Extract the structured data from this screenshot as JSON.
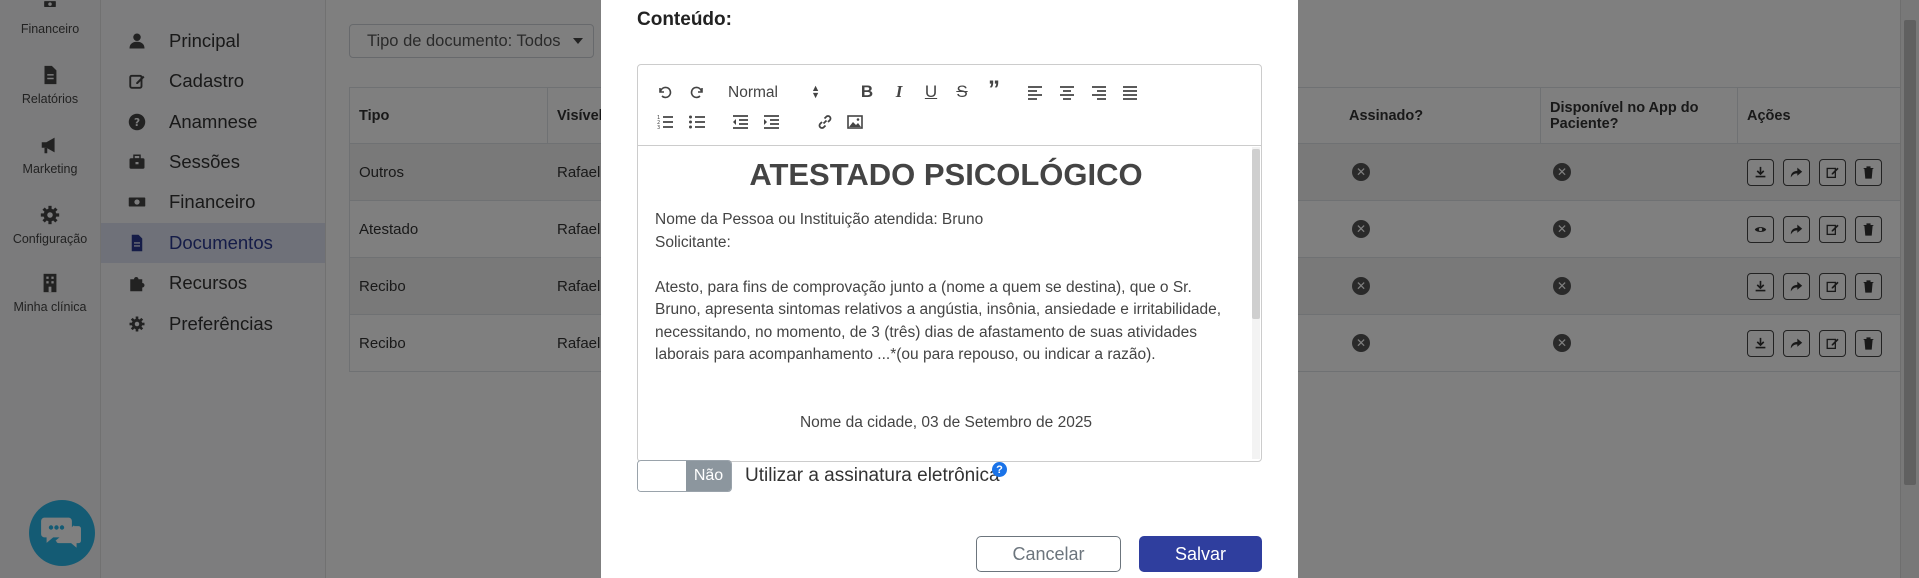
{
  "rail": {
    "items": [
      {
        "label": "Financeiro",
        "icon": "money-icon"
      },
      {
        "label": "Relatórios",
        "icon": "file-icon"
      },
      {
        "label": "Marketing",
        "icon": "megaphone-icon"
      },
      {
        "label": "Configuração",
        "icon": "gear-icon"
      },
      {
        "label": "Minha clínica",
        "icon": "building-icon"
      }
    ]
  },
  "menu": {
    "items": [
      {
        "label": "Principal",
        "icon": "user-icon"
      },
      {
        "label": "Cadastro",
        "icon": "edit-icon"
      },
      {
        "label": "Anamnese",
        "icon": "question-icon"
      },
      {
        "label": "Sessões",
        "icon": "briefcase-icon"
      },
      {
        "label": "Financeiro",
        "icon": "money-icon"
      },
      {
        "label": "Documentos",
        "icon": "file-icon",
        "active": true
      },
      {
        "label": "Recursos",
        "icon": "puzzle-icon"
      },
      {
        "label": "Preferências",
        "icon": "gear-icon"
      }
    ]
  },
  "filter": {
    "label": "Tipo de documento: Todos"
  },
  "table": {
    "headers": [
      "Tipo",
      "Visível",
      "Assinado?",
      "Disponível no App do Paciente?",
      "Ações"
    ],
    "rows": [
      {
        "tipo": "Outros",
        "visivel": "Rafael"
      },
      {
        "tipo": "Atestado",
        "visivel": "Rafael"
      },
      {
        "tipo": "Recibo",
        "visivel": "Rafael"
      },
      {
        "tipo": "Recibo",
        "visivel": "Rafael"
      }
    ]
  },
  "modal": {
    "section_title": "Conteúdo:",
    "toolbar": {
      "size": "Normal"
    },
    "content": {
      "heading": "ATESTADO PSICOLÓGICO",
      "line1": "Nome da Pessoa ou Instituição atendida: Bruno",
      "line2": "Solicitante:",
      "paragraph": "Atesto, para fins de comprovação junto a (nome a quem se destina), que o Sr. Bruno, apresenta sintomas relativos a angústia, insônia, ansiedade e irritabilidade, necessitando, no momento, de 3 (três) dias de afastamento de suas atividades laborais para acompanhamento ...*(ou para repouso, ou indicar a razão).",
      "date_line": "Nome da cidade, 03 de Setembro de 2025"
    },
    "toggle_label": "Não",
    "signature_label": "Utilizar a assinatura eletrônica",
    "help": "?",
    "cancel": "Cancelar",
    "save": "Salvar"
  },
  "colors": {
    "primary": "#2f3e9e",
    "active_menu_bg": "#dfe3f2",
    "chat": "#29b6e8"
  }
}
